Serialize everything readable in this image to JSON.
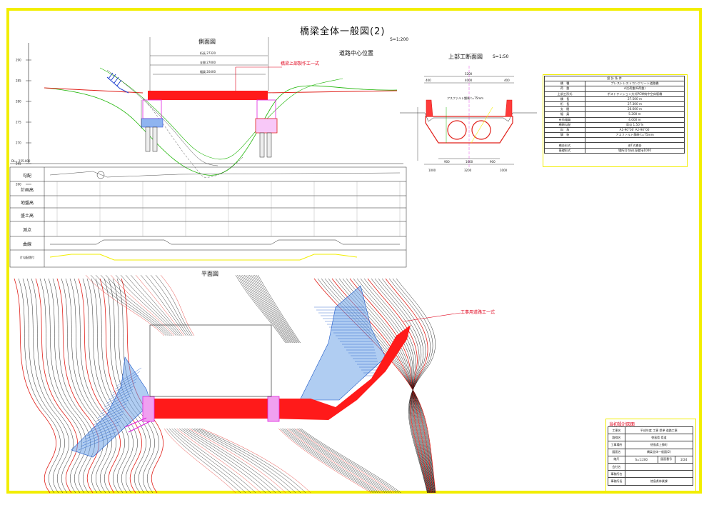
{
  "drawing": {
    "title": "橋梁全体一般図(2)",
    "scale": "S=1:200",
    "side_view_title": "側面図",
    "road_center_label": "道路中心位置",
    "cross_section_title": "上部工断面図",
    "cross_section_scale": "S=1:50",
    "plan_view_title": "平面図",
    "callout_superstructure": "橋梁上部製作工一式",
    "callout_road": "工事用道路工一式",
    "dim_length": "桁長 27320",
    "dim_span": "支間 27000",
    "dim_clear": "幅員 20400",
    "asphalt_label": "アスファルト舗装 t=75mm",
    "elevations": [
      "290",
      "285",
      "280",
      "275",
      "270",
      "265",
      "260"
    ],
    "base_level": "DL= 255.000",
    "cs_dims_top": [
      "5200",
      "400",
      "4000",
      "400"
    ],
    "cs_dims_bottom": [
      "1000",
      "3200",
      "1000"
    ],
    "cs_dims_mid": [
      "900",
      "1600",
      "900"
    ],
    "profile_rows": [
      "勾配",
      "計画高",
      "地盤高",
      "盛土高",
      "測点",
      "曲線",
      "片勾配摺付"
    ]
  },
  "spec_table": {
    "header": "設 計 条 件",
    "rows": [
      {
        "k": "橋　種",
        "v": "プレストレストコンクリート道路橋"
      },
      {
        "k": "荷　重",
        "v": "A活荷重(B荷重)"
      },
      {
        "k": "上部工形式",
        "v": "ポストテンション方式PC単純中空床版橋"
      },
      {
        "k": "橋　長",
        "v": "27.500 m"
      },
      {
        "k": "桁　長",
        "v": "27.300 m"
      },
      {
        "k": "支　間",
        "v": "26.600 m"
      },
      {
        "k": "幅　員",
        "v": "5.200 m"
      },
      {
        "k": "有効幅員",
        "v": "4.000 m"
      },
      {
        "k": "横断勾配",
        "v": "両勾 1.50 %"
      },
      {
        "k": "斜　角",
        "v": "A1-90°00′ A2-90°00′"
      },
      {
        "k": "舗　装",
        "v": "アスファルト舗装 t=75mm"
      },
      {
        "k": "",
        "v": ""
      },
      {
        "k": "橋台形式",
        "v": "逆T式橋台"
      },
      {
        "k": "基礎形式",
        "v": "場所打ち杭(深礎)φ1000"
      }
    ]
  },
  "title_block": {
    "header": "当初設計図面",
    "rows": [
      {
        "k": "工事名",
        "v": "平成年度 工事 県単 道路工事",
        "k2": "",
        "v2": ""
      },
      {
        "k": "路線名",
        "v": "徳島県 県道",
        "k2": "",
        "v2": ""
      },
      {
        "k": "工事場所",
        "v": "徳島県上勝町",
        "k2": "",
        "v2": ""
      },
      {
        "k": "図面名",
        "v": "橋梁全体一般図(2)",
        "k2": "",
        "v2": ""
      },
      {
        "k": "縮尺",
        "v": "S=1:200",
        "k2": "図面番号",
        "v2": "2/24"
      },
      {
        "k": "会社名",
        "v": "",
        "k2": "",
        "v2": ""
      },
      {
        "k": "事務所名",
        "v": "",
        "k2": "",
        "v2": ""
      },
      {
        "k": "事務所長",
        "v": "徳島県林業課",
        "k2": "",
        "v2": ""
      }
    ]
  },
  "colors": {
    "frame": "#f2ee00",
    "highlight": "#ff1a1a",
    "contour_black": "#111111",
    "contour_red": "#e0201a",
    "ground_green": "#19b400",
    "water_blue": "#3b7bd6",
    "magenta": "#e020e0"
  }
}
